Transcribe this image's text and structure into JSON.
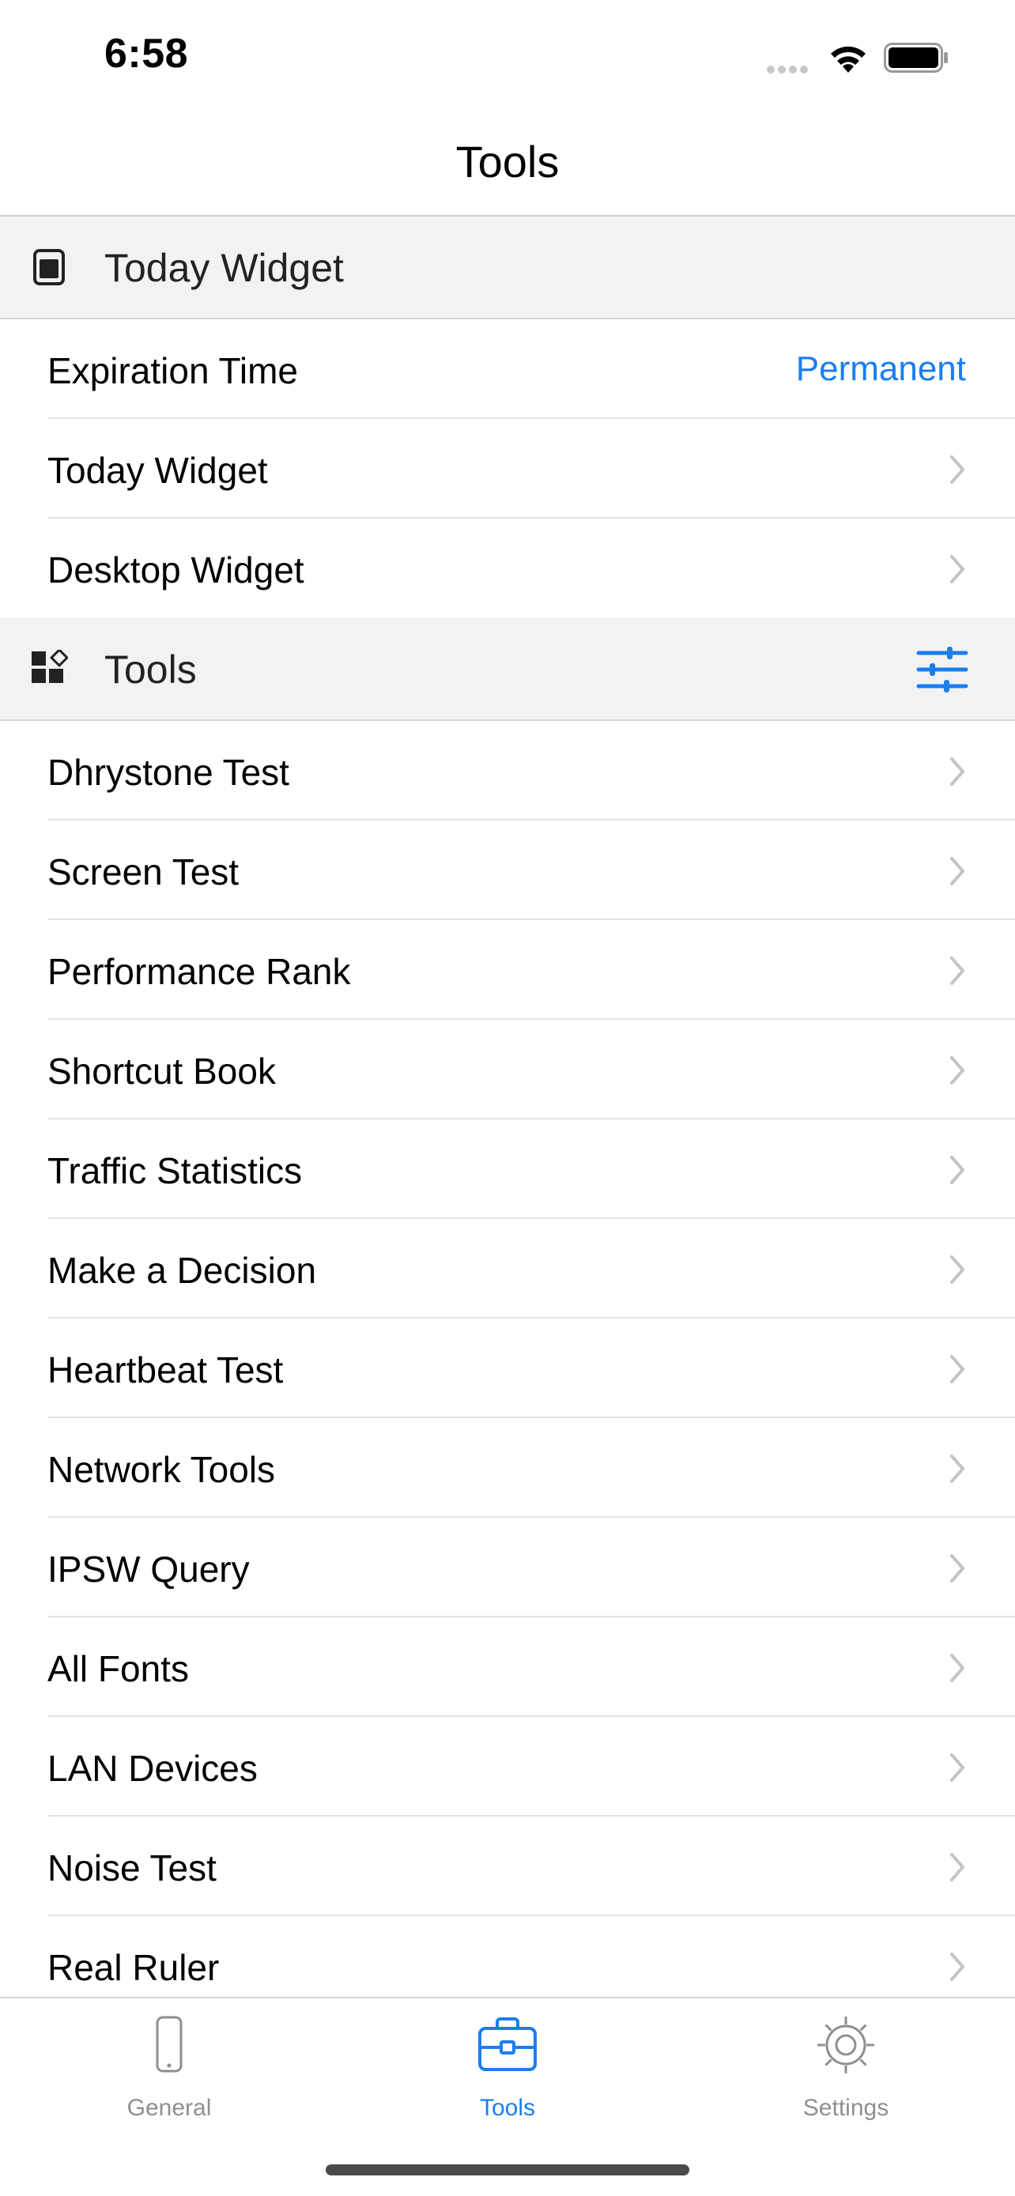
{
  "status_bar": {
    "time": "6:58"
  },
  "nav": {
    "title": "Tools"
  },
  "sections": {
    "today_widget": {
      "title": "Today Widget"
    },
    "tools": {
      "title": "Tools"
    }
  },
  "widget_rows": [
    {
      "label": "Expiration Time",
      "value": "Permanent"
    },
    {
      "label": "Today Widget"
    },
    {
      "label": "Desktop Widget"
    }
  ],
  "tool_rows": [
    {
      "label": "Dhrystone Test"
    },
    {
      "label": "Screen Test"
    },
    {
      "label": "Performance Rank"
    },
    {
      "label": "Shortcut Book"
    },
    {
      "label": "Traffic Statistics"
    },
    {
      "label": "Make a Decision"
    },
    {
      "label": "Heartbeat Test"
    },
    {
      "label": "Network Tools"
    },
    {
      "label": "IPSW Query"
    },
    {
      "label": "All Fonts"
    },
    {
      "label": "LAN Devices"
    },
    {
      "label": "Noise Test"
    },
    {
      "label": "Real Ruler"
    }
  ],
  "tab_bar": {
    "tabs": [
      {
        "label": "General",
        "icon": "phone-icon"
      },
      {
        "label": "Tools",
        "icon": "toolbox-icon",
        "active": true
      },
      {
        "label": "Settings",
        "icon": "gear-icon"
      }
    ]
  },
  "colors": {
    "accent": "#1a7ef0",
    "inactive": "#8e8e93",
    "section_bg": "#f2f2f2"
  }
}
